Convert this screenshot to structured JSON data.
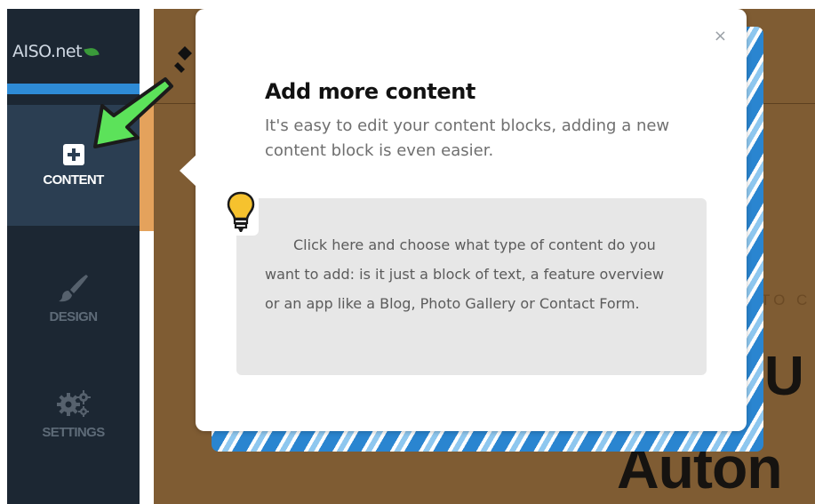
{
  "sidebar": {
    "logo_text": "AISO.net",
    "items": [
      {
        "label": "CONTENT",
        "icon": "plus-square-icon",
        "active": true
      },
      {
        "label": "DESIGN",
        "icon": "paintbrush-icon",
        "active": false
      },
      {
        "label": "SETTINGS",
        "icon": "gears-icon",
        "active": false
      }
    ]
  },
  "background": {
    "small_text": "TO C",
    "big_text_1": "U",
    "big_text_2": "Auton"
  },
  "popup": {
    "close_label": "×",
    "title": "Add more content",
    "subtitle": "It's easy to edit your content blocks, adding a new content block is even easier.",
    "tip_text": "Click here and choose what type of content do you want to add: is it just a block of text, a feature overview or an app like a Blog, Photo Gallery or Contact Form.",
    "tip_icon": "lightbulb-icon"
  },
  "colors": {
    "sidebar": "#1c2733",
    "sidebar_active": "#2b3e52",
    "accent_orange": "#e4a25c",
    "accent_blue": "#2e8bd6",
    "page_bg": "#7f5c33",
    "pointer_arrow": "#5ce25a"
  }
}
